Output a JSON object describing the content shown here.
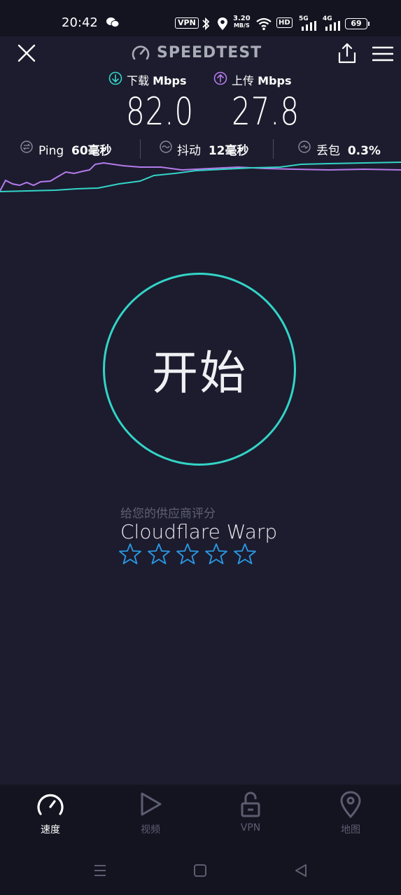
{
  "status_bar": {
    "time": "20:42",
    "vpn_badge": "VPN",
    "net_speed_value": "3.20",
    "net_speed_unit": "MB/S",
    "hd_badge": "HD",
    "sim1_label": "5G",
    "sim2_label": "4G",
    "battery": "69"
  },
  "header": {
    "logo_text": "SPEEDTEST"
  },
  "metrics": {
    "download_label": "下载",
    "download_unit": "Mbps",
    "download_value": "82.0",
    "upload_label": "上传",
    "upload_unit": "Mbps",
    "upload_value": "27.8"
  },
  "stats": {
    "ping_label": "Ping",
    "ping_value": "60毫秒",
    "jitter_label": "抖动",
    "jitter_value": "12毫秒",
    "loss_label": "丢包",
    "loss_value": "0.3%"
  },
  "start_button": {
    "label": "开始"
  },
  "rating": {
    "prompt": "给您的供应商评分",
    "provider": "Cloudflare Warp",
    "stars_total": 5,
    "stars_filled": 0
  },
  "nav": {
    "items": [
      {
        "label": "速度",
        "icon": "speedometer-icon",
        "active": true
      },
      {
        "label": "视频",
        "icon": "play-icon",
        "active": false
      },
      {
        "label": "VPN",
        "icon": "unlock-icon",
        "active": false
      },
      {
        "label": "地图",
        "icon": "map-pin-icon",
        "active": false
      }
    ]
  },
  "colors": {
    "background": "#1c1c2e",
    "accent_teal": "#33d4c7",
    "accent_purple": "#b57bea",
    "star_blue": "#2a9ae6"
  }
}
